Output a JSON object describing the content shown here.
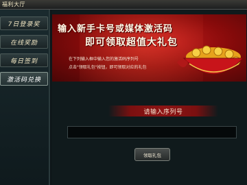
{
  "window": {
    "title": "福利大厅"
  },
  "sidebar": {
    "items": [
      {
        "label": "7日登录奖"
      },
      {
        "label": "在线奖励"
      },
      {
        "label": "每日签到"
      },
      {
        "label": "激活码兑换"
      }
    ],
    "active_index": 3
  },
  "banner": {
    "headline_line1": "输入新手卡号或媒体激活码",
    "headline_line2": "即可领取超值大礼包",
    "instruction_line1": "在下列输入框中输入您的激活码序列号",
    "instruction_line2": "点击\"领取礼包\"按钮，即可领取对应的礼包",
    "colors": {
      "background": "#a81414",
      "text": "#fffbe8"
    }
  },
  "redeem": {
    "prompt": "请输入序列号",
    "input_value": "",
    "input_placeholder": "",
    "button_label": "领取礼包"
  }
}
